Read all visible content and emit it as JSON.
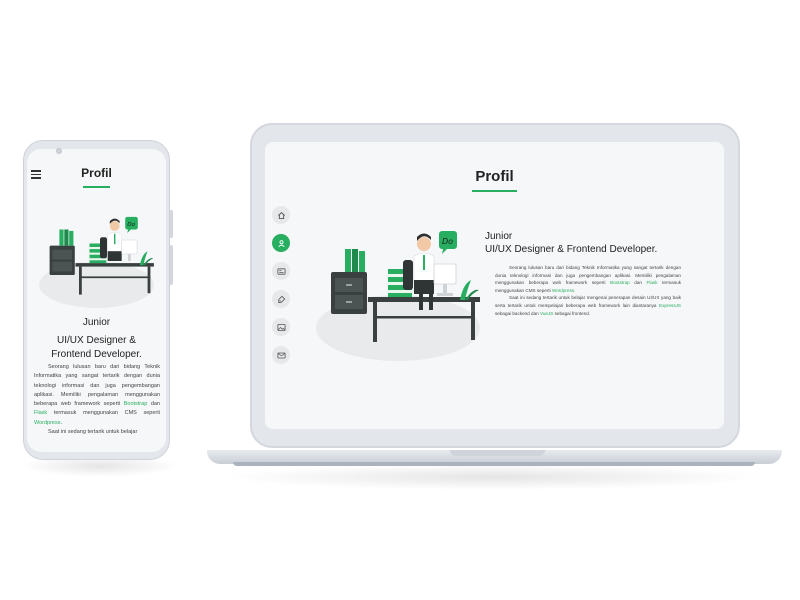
{
  "page": {
    "title": "Profil",
    "heading_line1": "Junior",
    "heading_line2": "UI/UX Designer & Frontend Developer.",
    "phone_heading_line2a": "UI/UX Designer &",
    "phone_heading_line2b": "Frontend Developer.",
    "paragraph1": {
      "text_before": "Seorang lulusan baru dari bidang Teknik Informatika yang sangat tertarik dengan dunia teknologi informasi dan juga pengembangan aplikasi. Memiliki pengalaman menggunakan beberapa web framework seperti ",
      "link1": "Bootstrap",
      "text_mid": " dan ",
      "link2": "Flask",
      "text_after": " termasuk menggunakan CMS seperti ",
      "link3": "Wordpress",
      "text_end": "."
    },
    "paragraph2": {
      "text_before": "Saat ini sedang tertarik untuk belajar mengenai penerapan desain UI/UX yang baik serta tertarik untuk mempelajari beberapa web framework lain diantaranya ",
      "link1": "ExpressJS",
      "text_mid": " sebagai backend dan ",
      "link2": "VueJS",
      "text_after": " sebagai frontend."
    },
    "phone_paragraph2_partial": "Saat ini sedang tertarik untuk belajar"
  },
  "nav": [
    {
      "icon": "home-icon",
      "active": false
    },
    {
      "icon": "user-icon",
      "active": true
    },
    {
      "icon": "id-card-icon",
      "active": false
    },
    {
      "icon": "brush-icon",
      "active": false
    },
    {
      "icon": "image-icon",
      "active": false
    },
    {
      "icon": "mail-icon",
      "active": false
    }
  ],
  "colors": {
    "accent": "#27ae60",
    "device": "#e3e6ea",
    "screen": "#f6f7f8",
    "text": "#222222"
  }
}
